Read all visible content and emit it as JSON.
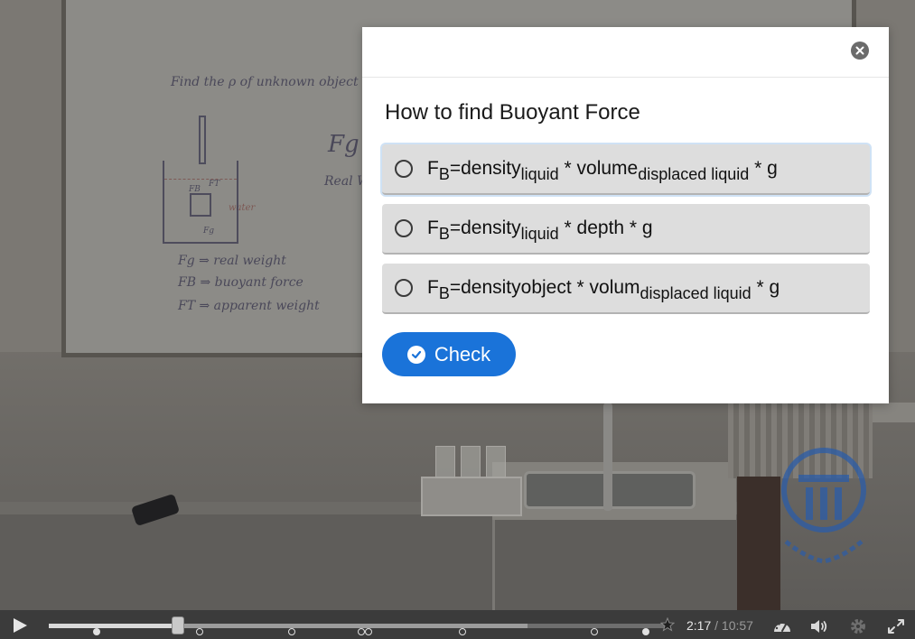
{
  "quiz": {
    "question": "How to find Buoyant Force",
    "answers": [
      {
        "prefix": "F",
        "prefix_sub": "B",
        "text1": "=density",
        "sub1": "liquid",
        "text2": " * volume",
        "sub2": "displaced liquid",
        "text3": " * g"
      },
      {
        "prefix": "F",
        "prefix_sub": "B",
        "text1": "=density",
        "sub1": "liquid",
        "text2": " * depth * g",
        "sub2": "",
        "text3": ""
      },
      {
        "prefix": "F",
        "prefix_sub": "B",
        "text1": "=densityobject * volum",
        "sub1": "displaced liquid",
        "text2": " * g",
        "sub2": "",
        "text3": ""
      }
    ],
    "check_label": "Check"
  },
  "whiteboard": {
    "line1": "Find the ρ of unknown object",
    "fg": "Fg",
    "real": "Real W",
    "water": "water",
    "legend1": "Fg ⇒ real weight",
    "legend2": "FB ⇒ buoyant force",
    "legend3": "FT ⇒ apparent weight",
    "label_fb": "FB",
    "label_ft": "FT",
    "label_fg": "Fg"
  },
  "player": {
    "current_time": "2:17",
    "separator": "/",
    "total_time": "10:57",
    "progress_fraction": 0.209,
    "icons": [
      "play-icon",
      "bookmark-star-icon",
      "speed-icon",
      "volume-icon",
      "settings-icon",
      "fullscreen-icon"
    ]
  },
  "colors": {
    "accent": "#1a73d9",
    "answer_bg": "#dddddd",
    "controls_bg": "#3b3b3b"
  }
}
